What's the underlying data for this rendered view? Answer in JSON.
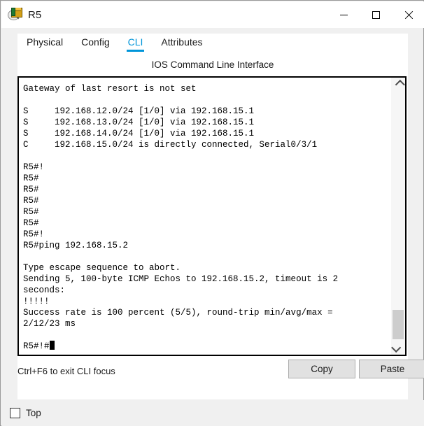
{
  "window": {
    "title": "R5",
    "icon": "router-device-icon",
    "controls": {
      "minimize": "Minimize",
      "maximize": "Maximize",
      "close": "Close"
    }
  },
  "tabs": [
    {
      "label": "Physical",
      "active": false
    },
    {
      "label": "Config",
      "active": false
    },
    {
      "label": "CLI",
      "active": true
    },
    {
      "label": "Attributes",
      "active": false
    }
  ],
  "panel": {
    "title": "IOS Command Line Interface"
  },
  "terminal": {
    "content": "Gateway of last resort is not set\n\nS     192.168.12.0/24 [1/0] via 192.168.15.1\nS     192.168.13.0/24 [1/0] via 192.168.15.1\nS     192.168.14.0/24 [1/0] via 192.168.15.1\nC     192.168.15.0/24 is directly connected, Serial0/3/1\n\nR5#!\nR5#\nR5#\nR5#\nR5#\nR5#\nR5#!\nR5#ping 192.168.15.2\n\nType escape sequence to abort.\nSending 5, 100-byte ICMP Echos to 192.168.15.2, timeout is 2\nseconds:\n!!!!!\nSuccess rate is 100 percent (5/5), round-trip min/avg/max =\n2/12/23 ms\n\nR5#!#",
    "scrollbar": {
      "up_arrow": "scroll-up",
      "down_arrow": "scroll-down",
      "position": "bottom"
    }
  },
  "footer": {
    "hint": "Ctrl+F6 to exit CLI focus",
    "copy_label": "Copy",
    "paste_label": "Paste"
  },
  "bottom": {
    "top_checkbox_label": "Top",
    "top_checkbox_checked": false
  },
  "colors": {
    "accent": "#0095d9",
    "window_bg": "#f0f0f0",
    "panel_bg": "#ffffff",
    "terminal_text": "#000000",
    "button_bg": "#e1e1e1"
  }
}
